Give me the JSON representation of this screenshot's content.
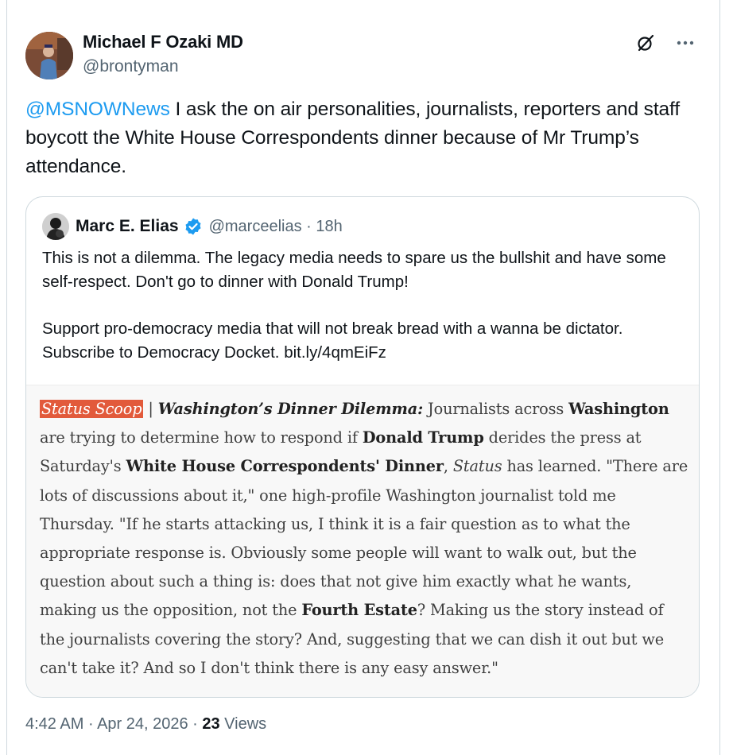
{
  "tweet": {
    "author_name": "Michael F Ozaki MD",
    "author_handle": "@brontyman",
    "mention": "@MSNOWNews",
    "text": " I ask the on air personalities, journalists, reporters and staff boycott the White House Correspondents dinner because of Mr Trump’s attendance."
  },
  "icons": {
    "grok": "grok-icon",
    "more": "more-icon",
    "verified": "verified-badge-icon"
  },
  "quote": {
    "author_name": "Marc E. Elias",
    "author_handle": "@marceelias",
    "separator": "·",
    "time": "18h",
    "paragraph1": "This is not a dilemma. The legacy media needs to spare us the bullshit and have some self-respect. Don't go to dinner with Donald Trump!",
    "paragraph2": "Support pro-democracy media that will not break bread with a wanna be dictator. Subscribe to Democracy Docket. bit.ly/4qmEiFz"
  },
  "article": {
    "tag": "Status Scoop",
    "sep": " | ",
    "headline": "Washington’s Dinner Dilemma:",
    "t1": " Journalists across ",
    "b1": "Washington",
    "t2": " are trying to determine how to respond if ",
    "b2": "Donald Trump",
    "t3": " derides the press at Saturday's ",
    "b3": "White House Correspondents' Dinner",
    "t4": ", ",
    "i1": "Status",
    "t5": " has learned. \"There are lots of discussions about it,\" one high-profile Washington journalist told me Thursday. \"If he starts attacking us, I think it is a fair question as to what the appropriate response is. Obviously some people will want to walk out, but the question about such a thing is: does that not give him exactly what he wants, making us the opposition, not the ",
    "b4": "Fourth Estate",
    "t6": "? Making us the story instead of the journalists covering the story? And, suggesting that we can dish it out but we can't take it? And so I don't think there is any easy answer.\""
  },
  "footer": {
    "time": "4:42 AM",
    "dot": " · ",
    "date": "Apr 24, 2026",
    "dot2": " · ",
    "views_count": "23",
    "views_label": " Views"
  },
  "colors": {
    "accent": "#1d9bf0",
    "scoop_tag": "#e25a3b"
  }
}
